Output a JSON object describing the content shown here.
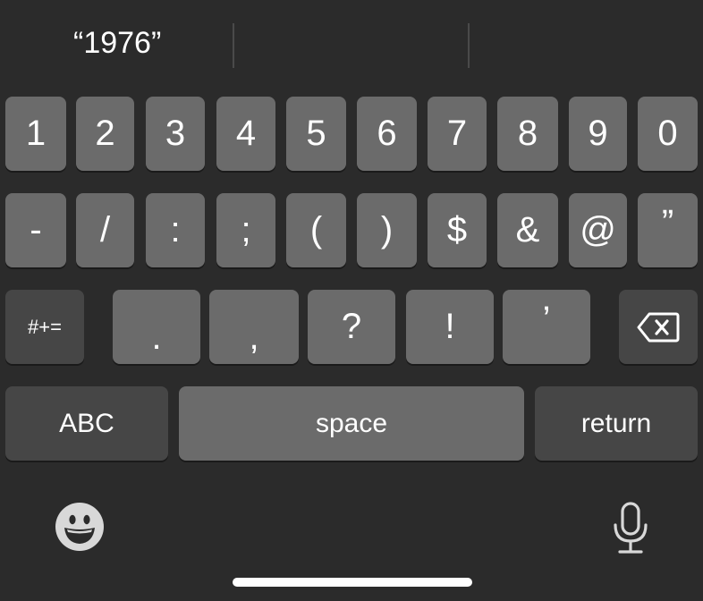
{
  "suggestions": [
    "“1976”",
    "",
    ""
  ],
  "row1": [
    "1",
    "2",
    "3",
    "4",
    "5",
    "6",
    "7",
    "8",
    "9",
    "0"
  ],
  "row2": [
    "-",
    "/",
    ":",
    ";",
    "(",
    ")",
    "$",
    "&",
    "@",
    "”"
  ],
  "row3": {
    "mode_key": "#+=",
    "keys": [
      ".",
      ",",
      "?",
      "!",
      "’"
    ]
  },
  "row4": {
    "abc": "ABC",
    "space": "space",
    "return": "return"
  },
  "icons": {
    "backspace": "backspace-icon",
    "emoji": "emoji-icon",
    "microphone": "microphone-icon"
  },
  "colors": {
    "background": "#2b2b2b",
    "key": "#6b6b6b",
    "function_key": "#464646",
    "text": "#ffffff"
  }
}
